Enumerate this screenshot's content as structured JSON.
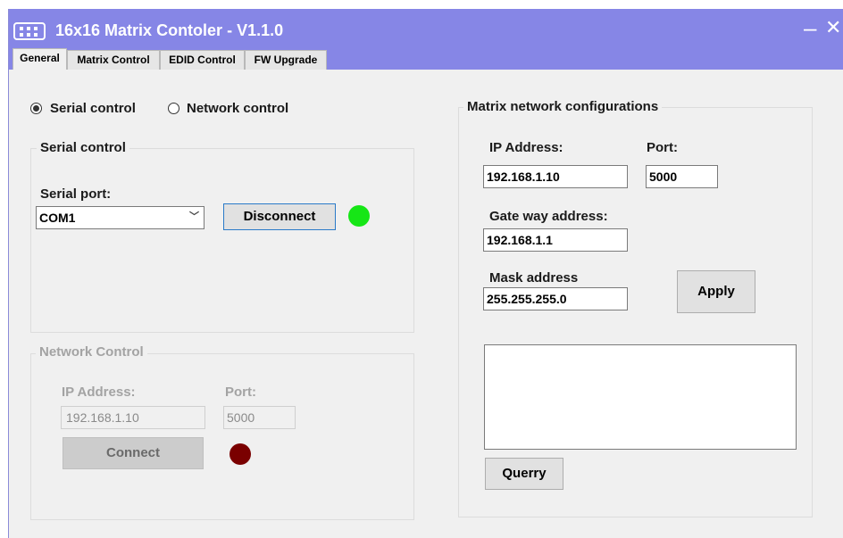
{
  "window": {
    "title": "16x16 Matrix Contoler - V1.1.0",
    "minimize_glyph": "–",
    "close_glyph": "✕",
    "icon": "matrix-app-icon"
  },
  "tabs": [
    {
      "label": "General",
      "active": true
    },
    {
      "label": "Matrix Control",
      "active": false
    },
    {
      "label": "EDID Control",
      "active": false
    },
    {
      "label": "FW Upgrade",
      "active": false
    }
  ],
  "mode": {
    "serial_label": "Serial control",
    "network_label": "Network control",
    "selected": "serial"
  },
  "serial_group": {
    "title": "Serial control",
    "port_label": "Serial port:",
    "port_value": "COM1",
    "button_label": "Disconnect",
    "status_color": "#16e616"
  },
  "network_group": {
    "title": "Network Control",
    "ip_label": "IP Address:",
    "ip_value": "192.168.1.10",
    "port_label": "Port:",
    "port_value": "5000",
    "button_label": "Connect",
    "status_color": "#7a0000",
    "enabled": false
  },
  "matrix_config": {
    "title": "Matrix network configurations",
    "ip_label": "IP Address:",
    "ip_value": "192.168.1.10",
    "port_label": "Port:",
    "port_value": "5000",
    "gateway_label": "Gate way address:",
    "gateway_value": "192.168.1.1",
    "mask_label": "Mask address",
    "mask_value": "255.255.255.0",
    "apply_label": "Apply",
    "output_text": "",
    "query_label": "Querry"
  },
  "colors": {
    "titlebar": "#8686e6",
    "background": "#f0f0f0"
  }
}
